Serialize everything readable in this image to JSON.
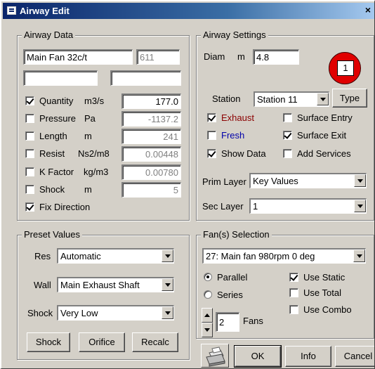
{
  "window": {
    "title": "Airway Edit",
    "close": "×"
  },
  "airway_data": {
    "title": "Airway Data",
    "name": "Main Fan 32c/t",
    "number": "611",
    "blank1": "",
    "blank2": "",
    "rows": [
      {
        "label": "Quantity",
        "unit": "m3/s",
        "value": "177.0",
        "checked": true
      },
      {
        "label": "Pressure",
        "unit": "Pa",
        "value": "-1137.2",
        "checked": false
      },
      {
        "label": "Length",
        "unit": "m",
        "value": "241",
        "checked": false
      },
      {
        "label": "Resist",
        "unit": "Ns2/m8",
        "value": "0.00448",
        "checked": false
      },
      {
        "label": "K Factor",
        "unit": "kg/m3",
        "value": "0.00780",
        "checked": false
      },
      {
        "label": "Shock",
        "unit": "m",
        "value": "5",
        "checked": false
      }
    ],
    "fix_direction": {
      "label": "Fix Direction",
      "checked": true
    }
  },
  "airway_settings": {
    "title": "Airway Settings",
    "diam_label": "Diam",
    "diam_unit": "m",
    "diam_value": "4.8",
    "badge_number": "1",
    "station_label": "Station",
    "station_value": "Station 11",
    "type_button": "Type",
    "checks": [
      {
        "label": "Exhaust",
        "checked": true,
        "color": "#8b0000"
      },
      {
        "label": "Surface Entry",
        "checked": false,
        "color": "#000000"
      },
      {
        "label": "Fresh",
        "checked": false,
        "color": "#0000aa"
      },
      {
        "label": "Surface Exit",
        "checked": true,
        "color": "#000000"
      },
      {
        "label": "Show Data",
        "checked": true,
        "color": "#000000"
      },
      {
        "label": "Add Services",
        "checked": false,
        "color": "#000000"
      }
    ],
    "prim_layer_label": "Prim Layer",
    "prim_layer_value": "Key Values",
    "sec_layer_label": "Sec Layer",
    "sec_layer_value": "1"
  },
  "preset_values": {
    "title": "Preset Values",
    "res_label": "Res",
    "res_value": "Automatic",
    "wall_label": "Wall",
    "wall_value": "Main Exhaust Shaft",
    "shock_label": "Shock",
    "shock_value": "Very Low",
    "buttons": {
      "shock": "Shock",
      "orifice": "Orifice",
      "recalc": "Recalc"
    }
  },
  "fan_selection": {
    "title": "Fan(s) Selection",
    "fan_value": "27: Main fan 980rpm 0 deg",
    "parallel": {
      "label": "Parallel",
      "selected": true
    },
    "series": {
      "label": "Series",
      "selected": false
    },
    "use_static": {
      "label": "Use Static",
      "checked": true
    },
    "use_total": {
      "label": "Use Total",
      "checked": false
    },
    "use_combo": {
      "label": "Use Combo",
      "checked": false
    },
    "fans_count": "2",
    "fans_label": "Fans"
  },
  "footer": {
    "ok": "OK",
    "info": "Info",
    "cancel": "Cancel"
  },
  "icons": {
    "printer": "printer-icon",
    "window": "window-icon"
  },
  "colors": {
    "title_start": "#0a246a",
    "title_end": "#a6caf0",
    "face": "#d4d0c8",
    "badge": "#e00000"
  }
}
